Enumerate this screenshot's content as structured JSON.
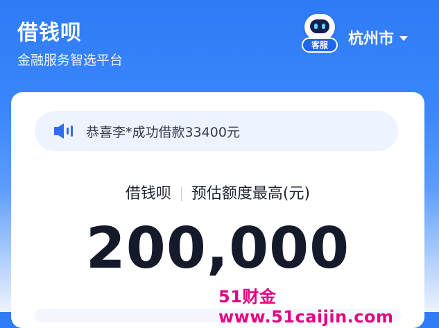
{
  "header": {
    "title": "借钱呗",
    "subtitle": "金融服务智选平台",
    "service_label": "客服",
    "city": "杭州市"
  },
  "notice": {
    "icon": "speaker-icon",
    "text": "恭喜李*成功借款33400元"
  },
  "quota": {
    "product": "借钱呗",
    "label": "预估额度最高(元)",
    "amount": "200,000"
  },
  "watermark": "51财金www.51caijin.com",
  "colors": {
    "primary": "#2f7bf6",
    "amount_text": "#151a2b",
    "watermark": "#e4007f"
  }
}
